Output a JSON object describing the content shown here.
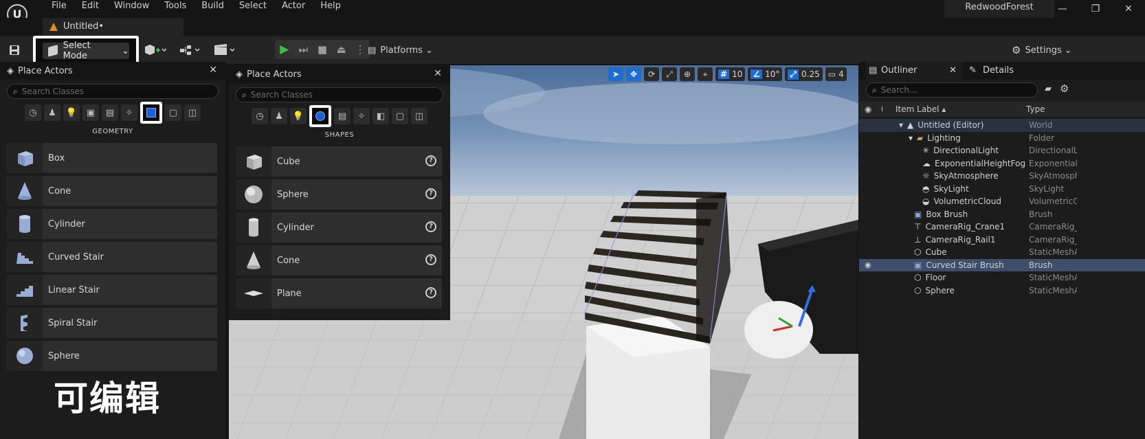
{
  "menubar": {
    "logo": "U",
    "items": [
      "File",
      "Edit",
      "Window",
      "Tools",
      "Build",
      "Select",
      "Actor",
      "Help"
    ],
    "project": "RedwoodForest",
    "window_buttons": [
      "—",
      "❐",
      "✕"
    ]
  },
  "tabs": {
    "document": "Untitled•"
  },
  "toolbar": {
    "select_mode": "Select Mode",
    "platforms": "Platforms",
    "settings": "Settings"
  },
  "place_actors_left": {
    "title": "Place Actors",
    "search_placeholder": "Search Classes",
    "category_label": "GEOMETRY",
    "items": [
      {
        "label": "Box"
      },
      {
        "label": "Cone"
      },
      {
        "label": "Cylinder"
      },
      {
        "label": "Curved Stair"
      },
      {
        "label": "Linear Stair"
      },
      {
        "label": "Spiral Stair"
      },
      {
        "label": "Sphere"
      }
    ]
  },
  "place_actors_right": {
    "title": "Place Actors",
    "search_placeholder": "Search Classes",
    "category_label": "SHAPES",
    "items": [
      {
        "label": "Cube"
      },
      {
        "label": "Sphere"
      },
      {
        "label": "Cylinder"
      },
      {
        "label": "Cone"
      },
      {
        "label": "Plane"
      }
    ]
  },
  "viewport_toolbar": {
    "grid": "10",
    "angle": "10°",
    "scale": "0.25",
    "camera_speed": "4"
  },
  "outliner": {
    "tab_outliner": "Outliner",
    "tab_details": "Details",
    "search_placeholder": "Search...",
    "col_label": "Item Label",
    "col_type": "Type",
    "rows": [
      {
        "label": "Untitled (Editor)",
        "type": "World"
      },
      {
        "label": "Lighting",
        "type": "Folder"
      },
      {
        "label": "DirectionalLight",
        "type": "DirectionalLi"
      },
      {
        "label": "ExponentialHeightFog",
        "type": "ExponentialH"
      },
      {
        "label": "SkyAtmosphere",
        "type": "SkyAtmosph"
      },
      {
        "label": "SkyLight",
        "type": "SkyLight"
      },
      {
        "label": "VolumetricCloud",
        "type": "VolumetricCl"
      },
      {
        "label": "Box Brush",
        "type": "Brush"
      },
      {
        "label": "CameraRig_Crane1",
        "type": "CameraRig_C"
      },
      {
        "label": "CameraRig_Rail1",
        "type": "CameraRig_R"
      },
      {
        "label": "Cube",
        "type": "StaticMeshA"
      },
      {
        "label": "Curved Stair Brush",
        "type": "Brush"
      },
      {
        "label": "Floor",
        "type": "StaticMeshA"
      },
      {
        "label": "Sphere",
        "type": "StaticMeshA"
      }
    ]
  },
  "caption": "可编辑"
}
